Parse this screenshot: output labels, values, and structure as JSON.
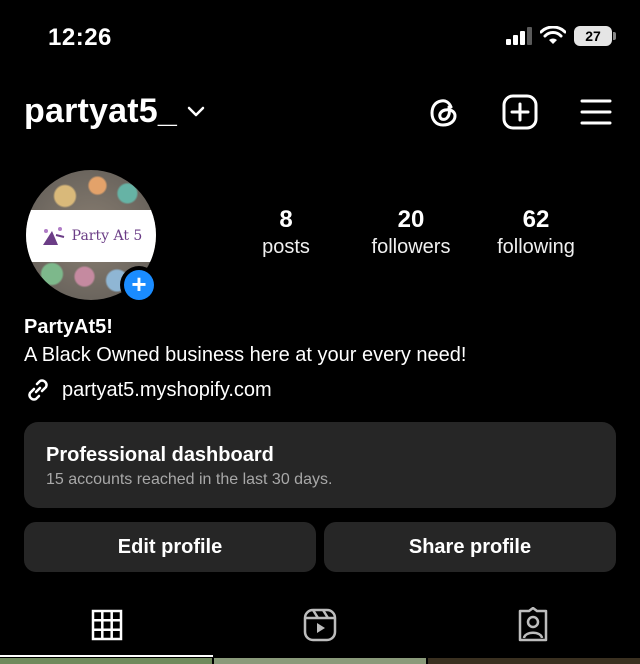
{
  "status_bar": {
    "time": "12:26",
    "battery": "27"
  },
  "header": {
    "username": "partyat5_"
  },
  "avatar": {
    "logo_text": "Party At 5"
  },
  "stats": [
    {
      "value": "8",
      "label": "posts"
    },
    {
      "value": "20",
      "label": "followers"
    },
    {
      "value": "62",
      "label": "following"
    }
  ],
  "bio": {
    "name": "PartyAt5!",
    "text": "A Black Owned business here at your every need!",
    "link": "partyat5.myshopify.com"
  },
  "dashboard": {
    "title": "Professional dashboard",
    "subtitle": "15 accounts reached in the last 30 days."
  },
  "buttons": {
    "edit": "Edit profile",
    "share": "Share profile"
  },
  "colors": {
    "accent": "#1a8cff",
    "card": "#262626",
    "background": "#000000"
  }
}
